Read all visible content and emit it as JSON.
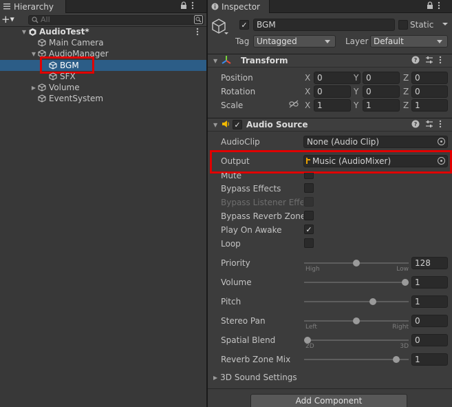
{
  "hierarchy": {
    "tab_label": "Hierarchy",
    "search_placeholder": "All",
    "items": [
      {
        "label": "AudioTest*",
        "indent": 0,
        "expanded": true,
        "kind": "scene"
      },
      {
        "label": "Main Camera",
        "indent": 1,
        "expanded": null,
        "kind": "object"
      },
      {
        "label": "AudioManager",
        "indent": 1,
        "expanded": true,
        "kind": "object"
      },
      {
        "label": "BGM",
        "indent": 2,
        "expanded": null,
        "kind": "object",
        "selected": true
      },
      {
        "label": "SFX",
        "indent": 2,
        "expanded": null,
        "kind": "object"
      },
      {
        "label": "Volume",
        "indent": 1,
        "expanded": false,
        "kind": "object"
      },
      {
        "label": "EventSystem",
        "indent": 1,
        "expanded": null,
        "kind": "object"
      }
    ]
  },
  "inspector": {
    "tab_label": "Inspector",
    "object_name": "BGM",
    "active_checked": true,
    "static_label": "Static",
    "static_checked": false,
    "tag_label": "Tag",
    "tag_value": "Untagged",
    "layer_label": "Layer",
    "layer_value": "Default",
    "transform": {
      "title": "Transform",
      "rows": [
        {
          "label": "Position",
          "x": "0",
          "y": "0",
          "z": "0"
        },
        {
          "label": "Rotation",
          "x": "0",
          "y": "0",
          "z": "0"
        },
        {
          "label": "Scale",
          "x": "1",
          "y": "1",
          "z": "1"
        }
      ],
      "axes": [
        "X",
        "Y",
        "Z"
      ]
    },
    "audio_source": {
      "title": "Audio Source",
      "enabled": true,
      "audioclip_label": "AudioClip",
      "audioclip_value": "None (Audio Clip)",
      "output_label": "Output",
      "output_value": "Music (AudioMixer)",
      "toggles": [
        {
          "label": "Mute",
          "checked": false,
          "disabled": false
        },
        {
          "label": "Bypass Effects",
          "checked": false,
          "disabled": false
        },
        {
          "label": "Bypass Listener Effects",
          "checked": false,
          "disabled": true
        },
        {
          "label": "Bypass Reverb Zones",
          "checked": false,
          "disabled": false
        },
        {
          "label": "Play On Awake",
          "checked": true,
          "disabled": false
        },
        {
          "label": "Loop",
          "checked": false,
          "disabled": false
        }
      ],
      "sliders": [
        {
          "label": "Priority",
          "value": "128",
          "level": 0.5,
          "left_caption": "High",
          "right_caption": "Low"
        },
        {
          "label": "Volume",
          "value": "1",
          "level": 1.0,
          "left_caption": "",
          "right_caption": ""
        },
        {
          "label": "Pitch",
          "value": "1",
          "level": 0.67,
          "left_caption": "",
          "right_caption": ""
        },
        {
          "label": "Stereo Pan",
          "value": "0",
          "level": 0.5,
          "left_caption": "Left",
          "right_caption": "Right"
        },
        {
          "label": "Spatial Blend",
          "value": "0",
          "level": 0.0,
          "left_caption": "2D",
          "right_caption": "3D"
        },
        {
          "label": "Reverb Zone Mix",
          "value": "1",
          "level": 0.91,
          "left_caption": "",
          "right_caption": ""
        }
      ],
      "sound_settings_label": "3D Sound Settings"
    },
    "add_component_label": "Add Component"
  },
  "colors": {
    "selection": "#2c5d87",
    "highlight": "#e00000",
    "audio_icon": "#f0b800",
    "mixer_icon": "#e8a000"
  }
}
